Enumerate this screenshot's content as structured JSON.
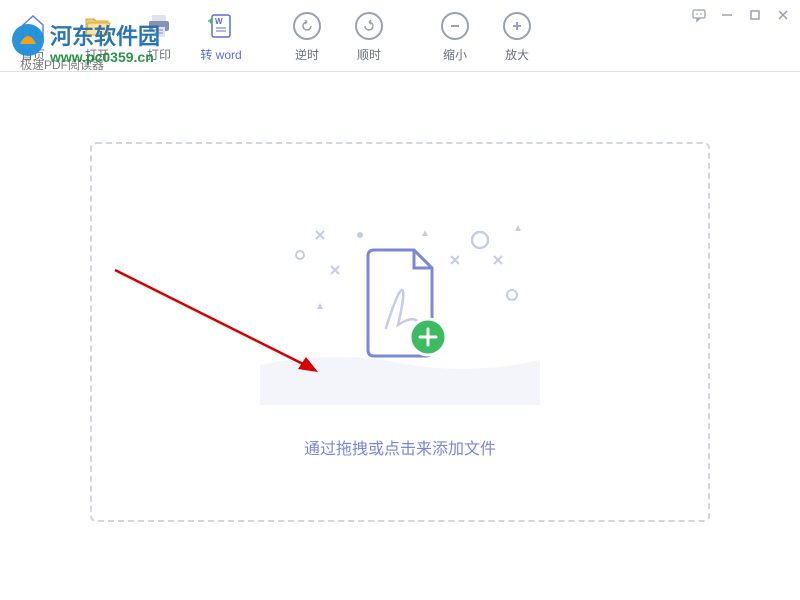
{
  "app": {
    "title_overlay": "极速PDF阅读器",
    "watermark_text": "河东软件园",
    "watermark_url": "www.pc0359.cn"
  },
  "toolbar": {
    "items": [
      {
        "label": "首页",
        "icon": "home-icon"
      },
      {
        "label": "打开",
        "icon": "open-icon"
      },
      {
        "label": "打印",
        "icon": "print-icon"
      },
      {
        "label": "转 word",
        "icon": "word-icon",
        "active": true
      },
      {
        "label": "逆时",
        "icon": "rotate-ccw-icon"
      },
      {
        "label": "顺时",
        "icon": "rotate-cw-icon"
      },
      {
        "label": "缩小",
        "icon": "zoom-out-icon"
      },
      {
        "label": "放大",
        "icon": "zoom-in-icon"
      }
    ]
  },
  "dropzone": {
    "text": "通过拖拽或点击来添加文件"
  },
  "colors": {
    "accent": "#5b6dd9",
    "muted": "#9aa0b4",
    "success": "#3dbb61"
  }
}
